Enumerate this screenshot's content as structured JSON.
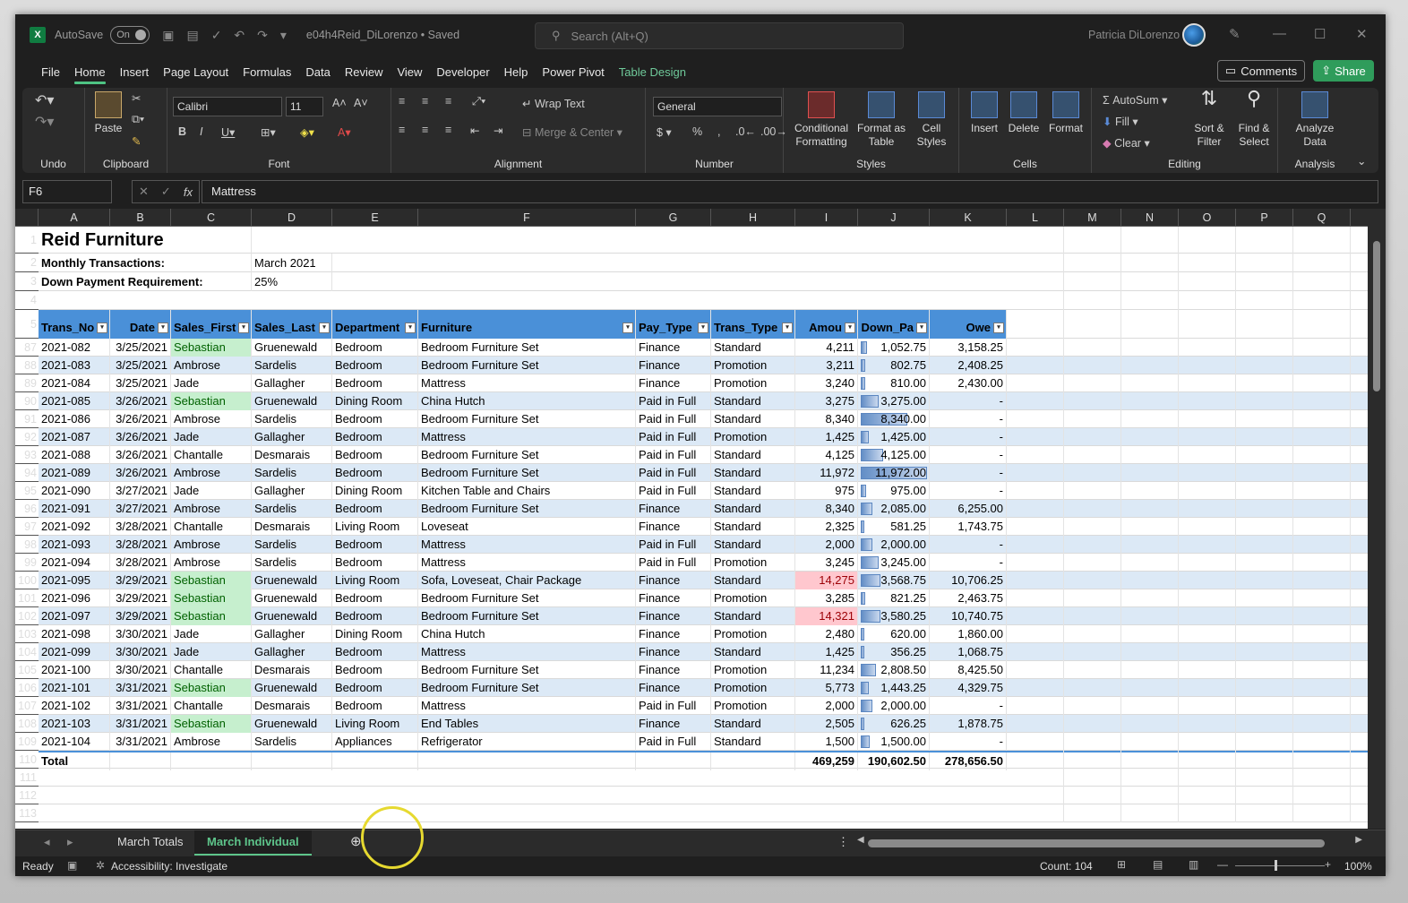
{
  "titlebar": {
    "autosave_label": "AutoSave",
    "autosave_state": "On",
    "filename": "e04h4Reid_DiLorenzo • Saved",
    "search_placeholder": "Search (Alt+Q)",
    "user": "Patricia DiLorenzo",
    "app_icon_letter": "X"
  },
  "menu": [
    "File",
    "Home",
    "Insert",
    "Page Layout",
    "Formulas",
    "Data",
    "Review",
    "View",
    "Developer",
    "Help",
    "Power Pivot",
    "Table Design"
  ],
  "menu_active": "Home",
  "buttons": {
    "comments": "Comments",
    "share": "Share"
  },
  "ribbon": {
    "groups": [
      "Undo",
      "Clipboard",
      "Font",
      "Alignment",
      "Number",
      "Styles",
      "Cells",
      "Editing",
      "Analysis"
    ],
    "paste": "Paste",
    "font_name": "Calibri",
    "font_size": "11",
    "wrap_text": "Wrap Text",
    "merge_center": "Merge & Center",
    "number_format": "General",
    "conditional_formatting": "Conditional Formatting",
    "format_as_table": "Format as Table",
    "cell_styles": "Cell Styles",
    "insert": "Insert",
    "delete": "Delete",
    "format": "Format",
    "autosum": "AutoSum",
    "fill": "Fill",
    "clear": "Clear",
    "sort_filter": "Sort & Filter",
    "find_select": "Find & Select",
    "analyze_data": "Analyze Data"
  },
  "formula_bar": {
    "name_box": "F6",
    "formula": "Mattress"
  },
  "columns": [
    "A",
    "B",
    "C",
    "D",
    "E",
    "F",
    "G",
    "H",
    "I",
    "J",
    "K",
    "L",
    "M",
    "N",
    "O",
    "P",
    "Q"
  ],
  "top_rows": {
    "r1": {
      "num": "1",
      "title": "Reid Furniture"
    },
    "r2": {
      "num": "2",
      "label": "Monthly Transactions:",
      "value": "March 2021"
    },
    "r3": {
      "num": "3",
      "label": "Down Payment Requirement:",
      "value": "25%"
    },
    "r4": {
      "num": "4"
    },
    "r5": {
      "num": "5"
    }
  },
  "headers": [
    "Trans_No",
    "Date",
    "Sales_First",
    "Sales_Last",
    "Department",
    "Furniture",
    "Pay_Type",
    "Trans_Type",
    "Amou",
    "Down_Pa",
    "Owe"
  ],
  "rows": [
    {
      "n": "87",
      "t": "2021-082",
      "d": "3/25/2021",
      "f": "Sebastian",
      "l": "Gruenewald",
      "dep": "Bedroom",
      "fur": "Bedroom Furniture Set",
      "p": "Finance",
      "tt": "Standard",
      "a": "4,211",
      "dp": "1,052.75",
      "o": "3,158.25",
      "hf": true,
      "ha": false,
      "bar": 0.09
    },
    {
      "n": "88",
      "t": "2021-083",
      "d": "3/25/2021",
      "f": "Ambrose",
      "l": "Sardelis",
      "dep": "Bedroom",
      "fur": "Bedroom Furniture Set",
      "p": "Finance",
      "tt": "Promotion",
      "a": "3,211",
      "dp": "802.75",
      "o": "2,408.25",
      "hf": false,
      "ha": false,
      "bar": 0.07
    },
    {
      "n": "89",
      "t": "2021-084",
      "d": "3/25/2021",
      "f": "Jade",
      "l": "Gallagher",
      "dep": "Bedroom",
      "fur": "Mattress",
      "p": "Finance",
      "tt": "Promotion",
      "a": "3,240",
      "dp": "810.00",
      "o": "2,430.00",
      "hf": false,
      "ha": false,
      "bar": 0.07
    },
    {
      "n": "90",
      "t": "2021-085",
      "d": "3/26/2021",
      "f": "Sebastian",
      "l": "Gruenewald",
      "dep": "Dining Room",
      "fur": "China Hutch",
      "p": "Paid in Full",
      "tt": "Standard",
      "a": "3,275",
      "dp": "3,275.00",
      "o": "-",
      "hf": true,
      "ha": false,
      "bar": 0.27
    },
    {
      "n": "91",
      "t": "2021-086",
      "d": "3/26/2021",
      "f": "Ambrose",
      "l": "Sardelis",
      "dep": "Bedroom",
      "fur": "Bedroom Furniture Set",
      "p": "Paid in Full",
      "tt": "Standard",
      "a": "8,340",
      "dp": "8,340.00",
      "o": "-",
      "hf": false,
      "ha": false,
      "bar": 0.7
    },
    {
      "n": "92",
      "t": "2021-087",
      "d": "3/26/2021",
      "f": "Jade",
      "l": "Gallagher",
      "dep": "Bedroom",
      "fur": "Mattress",
      "p": "Paid in Full",
      "tt": "Promotion",
      "a": "1,425",
      "dp": "1,425.00",
      "o": "-",
      "hf": false,
      "ha": false,
      "bar": 0.12
    },
    {
      "n": "93",
      "t": "2021-088",
      "d": "3/26/2021",
      "f": "Chantalle",
      "l": "Desmarais",
      "dep": "Bedroom",
      "fur": "Bedroom Furniture Set",
      "p": "Paid in Full",
      "tt": "Standard",
      "a": "4,125",
      "dp": "4,125.00",
      "o": "-",
      "hf": false,
      "ha": false,
      "bar": 0.34
    },
    {
      "n": "94",
      "t": "2021-089",
      "d": "3/26/2021",
      "f": "Ambrose",
      "l": "Sardelis",
      "dep": "Bedroom",
      "fur": "Bedroom Furniture Set",
      "p": "Paid in Full",
      "tt": "Standard",
      "a": "11,972",
      "dp": "11,972.00",
      "o": "-",
      "hf": false,
      "ha": false,
      "bar": 1.0
    },
    {
      "n": "95",
      "t": "2021-090",
      "d": "3/27/2021",
      "f": "Jade",
      "l": "Gallagher",
      "dep": "Dining Room",
      "fur": "Kitchen Table and Chairs",
      "p": "Paid in Full",
      "tt": "Standard",
      "a": "975",
      "dp": "975.00",
      "o": "-",
      "hf": false,
      "ha": false,
      "bar": 0.08
    },
    {
      "n": "96",
      "t": "2021-091",
      "d": "3/27/2021",
      "f": "Ambrose",
      "l": "Sardelis",
      "dep": "Bedroom",
      "fur": "Bedroom Furniture Set",
      "p": "Finance",
      "tt": "Standard",
      "a": "8,340",
      "dp": "2,085.00",
      "o": "6,255.00",
      "hf": false,
      "ha": false,
      "bar": 0.17
    },
    {
      "n": "97",
      "t": "2021-092",
      "d": "3/28/2021",
      "f": "Chantalle",
      "l": "Desmarais",
      "dep": "Living Room",
      "fur": "Loveseat",
      "p": "Finance",
      "tt": "Standard",
      "a": "2,325",
      "dp": "581.25",
      "o": "1,743.75",
      "hf": false,
      "ha": false,
      "bar": 0.05
    },
    {
      "n": "98",
      "t": "2021-093",
      "d": "3/28/2021",
      "f": "Ambrose",
      "l": "Sardelis",
      "dep": "Bedroom",
      "fur": "Mattress",
      "p": "Paid in Full",
      "tt": "Standard",
      "a": "2,000",
      "dp": "2,000.00",
      "o": "-",
      "hf": false,
      "ha": false,
      "bar": 0.17
    },
    {
      "n": "99",
      "t": "2021-094",
      "d": "3/28/2021",
      "f": "Ambrose",
      "l": "Sardelis",
      "dep": "Bedroom",
      "fur": "Mattress",
      "p": "Paid in Full",
      "tt": "Promotion",
      "a": "3,245",
      "dp": "3,245.00",
      "o": "-",
      "hf": false,
      "ha": false,
      "bar": 0.27
    },
    {
      "n": "100",
      "t": "2021-095",
      "d": "3/29/2021",
      "f": "Sebastian",
      "l": "Gruenewald",
      "dep": "Living Room",
      "fur": "Sofa, Loveseat, Chair Package",
      "p": "Finance",
      "tt": "Standard",
      "a": "14,275",
      "dp": "3,568.75",
      "o": "10,706.25",
      "hf": true,
      "ha": true,
      "bar": 0.3
    },
    {
      "n": "101",
      "t": "2021-096",
      "d": "3/29/2021",
      "f": "Sebastian",
      "l": "Gruenewald",
      "dep": "Bedroom",
      "fur": "Bedroom Furniture Set",
      "p": "Finance",
      "tt": "Promotion",
      "a": "3,285",
      "dp": "821.25",
      "o": "2,463.75",
      "hf": true,
      "ha": false,
      "bar": 0.07
    },
    {
      "n": "102",
      "t": "2021-097",
      "d": "3/29/2021",
      "f": "Sebastian",
      "l": "Gruenewald",
      "dep": "Bedroom",
      "fur": "Bedroom Furniture Set",
      "p": "Finance",
      "tt": "Standard",
      "a": "14,321",
      "dp": "3,580.25",
      "o": "10,740.75",
      "hf": true,
      "ha": true,
      "bar": 0.3
    },
    {
      "n": "103",
      "t": "2021-098",
      "d": "3/30/2021",
      "f": "Jade",
      "l": "Gallagher",
      "dep": "Dining Room",
      "fur": "China Hutch",
      "p": "Finance",
      "tt": "Promotion",
      "a": "2,480",
      "dp": "620.00",
      "o": "1,860.00",
      "hf": false,
      "ha": false,
      "bar": 0.05
    },
    {
      "n": "104",
      "t": "2021-099",
      "d": "3/30/2021",
      "f": "Jade",
      "l": "Gallagher",
      "dep": "Bedroom",
      "fur": "Mattress",
      "p": "Finance",
      "tt": "Standard",
      "a": "1,425",
      "dp": "356.25",
      "o": "1,068.75",
      "hf": false,
      "ha": false,
      "bar": 0.03
    },
    {
      "n": "105",
      "t": "2021-100",
      "d": "3/30/2021",
      "f": "Chantalle",
      "l": "Desmarais",
      "dep": "Bedroom",
      "fur": "Bedroom Furniture Set",
      "p": "Finance",
      "tt": "Promotion",
      "a": "11,234",
      "dp": "2,808.50",
      "o": "8,425.50",
      "hf": false,
      "ha": false,
      "bar": 0.23
    },
    {
      "n": "106",
      "t": "2021-101",
      "d": "3/31/2021",
      "f": "Sebastian",
      "l": "Gruenewald",
      "dep": "Bedroom",
      "fur": "Bedroom Furniture Set",
      "p": "Finance",
      "tt": "Promotion",
      "a": "5,773",
      "dp": "1,443.25",
      "o": "4,329.75",
      "hf": true,
      "ha": false,
      "bar": 0.12
    },
    {
      "n": "107",
      "t": "2021-102",
      "d": "3/31/2021",
      "f": "Chantalle",
      "l": "Desmarais",
      "dep": "Bedroom",
      "fur": "Mattress",
      "p": "Paid in Full",
      "tt": "Promotion",
      "a": "2,000",
      "dp": "2,000.00",
      "o": "-",
      "hf": false,
      "ha": false,
      "bar": 0.17
    },
    {
      "n": "108",
      "t": "2021-103",
      "d": "3/31/2021",
      "f": "Sebastian",
      "l": "Gruenewald",
      "dep": "Living Room",
      "fur": "End Tables",
      "p": "Finance",
      "tt": "Standard",
      "a": "2,505",
      "dp": "626.25",
      "o": "1,878.75",
      "hf": true,
      "ha": false,
      "bar": 0.05
    },
    {
      "n": "109",
      "t": "2021-104",
      "d": "3/31/2021",
      "f": "Ambrose",
      "l": "Sardelis",
      "dep": "Appliances",
      "fur": "Refrigerator",
      "p": "Paid in Full",
      "tt": "Standard",
      "a": "1,500",
      "dp": "1,500.00",
      "o": "-",
      "hf": false,
      "ha": false,
      "bar": 0.13
    }
  ],
  "total": {
    "n": "110",
    "label": "Total",
    "a": "469,259",
    "dp": "190,602.50",
    "o": "278,656.50"
  },
  "empty_rows": [
    "111",
    "112",
    "113"
  ],
  "sheet_tabs": [
    "March Totals",
    "March Individual"
  ],
  "active_tab": "March Individual",
  "status": {
    "ready": "Ready",
    "accessibility": "Accessibility: Investigate",
    "count": "Count: 104",
    "zoom": "100%"
  },
  "colors": {
    "accent": "#4ec383",
    "table_header": "#4a90d8",
    "band": "#dce9f6",
    "green_fill": "#c6efce",
    "red_fill": "#ffc7ce"
  }
}
